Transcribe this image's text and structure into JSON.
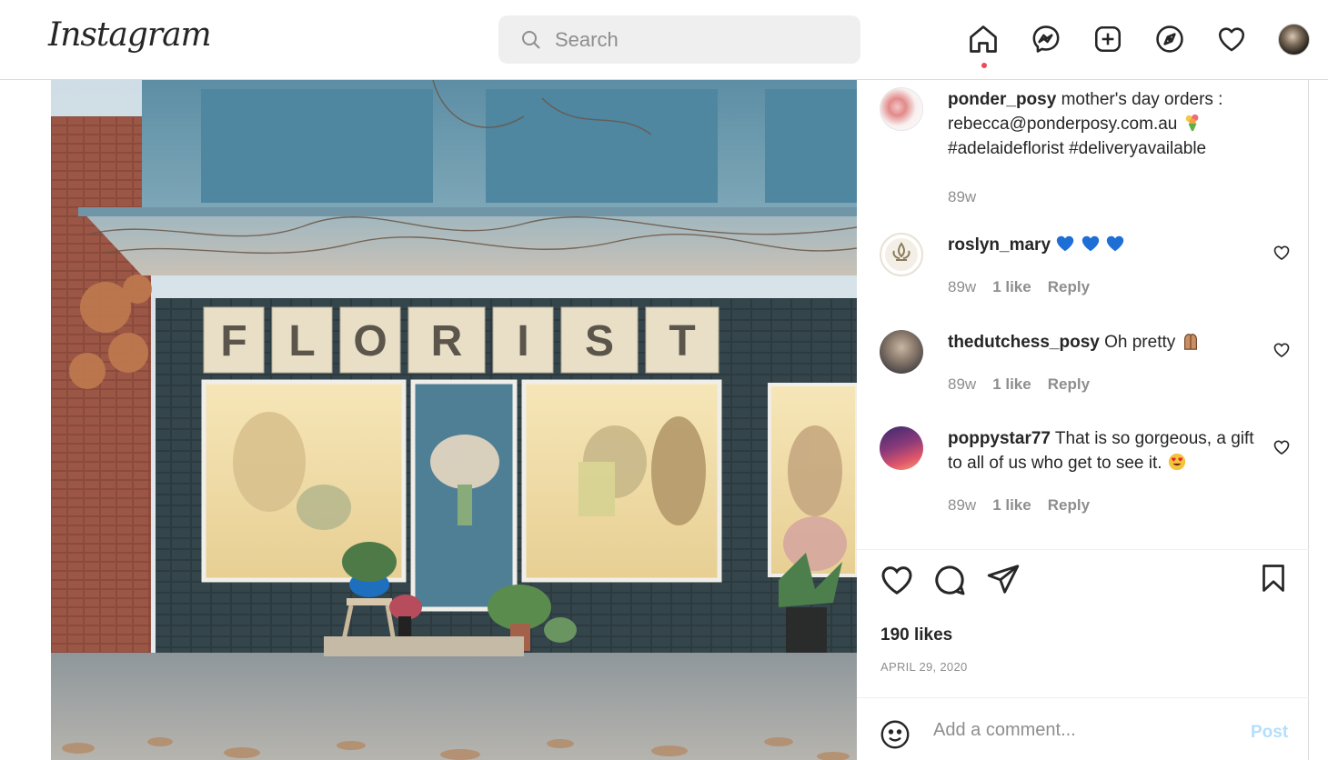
{
  "header": {
    "logo_text": "Instagram",
    "search_placeholder": "Search",
    "nav_icons": [
      "home-icon",
      "messenger-icon",
      "new-post-icon",
      "explore-icon",
      "activity-heart-icon",
      "profile-avatar"
    ]
  },
  "post": {
    "image_sign_text": "FLORIST",
    "caption": {
      "username": "ponder_posy",
      "text": "mother's day orders : rebecca@ponderposy.com.au",
      "hashtags": "#adelaideflorist #deliveryavailable",
      "time": "89w"
    },
    "comments": [
      {
        "username": "roslyn_mary",
        "text": "",
        "time": "89w",
        "likes": "1 like",
        "reply": "Reply"
      },
      {
        "username": "thedutchess_posy",
        "text": "Oh pretty",
        "time": "89w",
        "likes": "1 like",
        "reply": "Reply"
      },
      {
        "username": "poppystar77",
        "text": "That is so gorgeous, a gift to all of us who get to see it.",
        "time": "89w",
        "likes": "1 like",
        "reply": "Reply"
      }
    ],
    "likes_text": "190 likes",
    "date": "APRIL 29, 2020",
    "add_comment_placeholder": "Add a comment...",
    "post_button": "Post"
  },
  "colors": {
    "accent_blue_disabled": "#b2dffc",
    "notification_dot": "#ed4956",
    "muted_text": "#8e8e8e"
  }
}
